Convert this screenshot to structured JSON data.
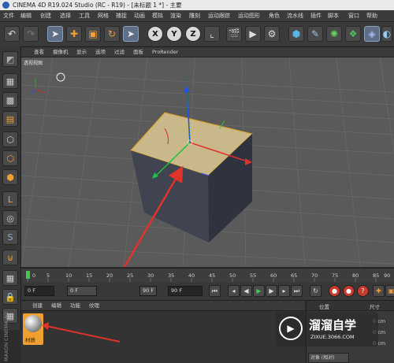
{
  "window": {
    "title": "CINEMA 4D R19.024 Studio (RC - R19) - [未标题 1 *] - 主要"
  },
  "menubar": {
    "items": [
      "文件",
      "编辑",
      "创建",
      "选择",
      "工具",
      "网格",
      "捕捉",
      "动画",
      "模拟",
      "渲染",
      "雕刻",
      "运动跟踪",
      "运动图形",
      "角色",
      "流水线",
      "插件",
      "脚本",
      "窗口",
      "帮助"
    ]
  },
  "toolbar": {
    "undo_icon": "undo-icon",
    "axis_x": "X",
    "axis_y": "Y",
    "axis_z": "Z"
  },
  "viewport": {
    "menu": [
      "查看",
      "摄像机",
      "显示",
      "选项",
      "过滤",
      "面板",
      "ProRender"
    ],
    "label": "透视视图"
  },
  "timeline": {
    "ticks": [
      "0",
      "5",
      "10",
      "15",
      "20",
      "25",
      "30",
      "35",
      "40",
      "45",
      "50",
      "55",
      "60",
      "65",
      "70",
      "75",
      "80",
      "85",
      "90"
    ]
  },
  "transport": {
    "start_field": "0 F",
    "current_field": "0 F",
    "end_field": "90 F",
    "end_field2": "90 F"
  },
  "material_panel": {
    "menu": [
      "创建",
      "编辑",
      "功能",
      "纹理"
    ],
    "material_name": "材质"
  },
  "attr_panel": {
    "header_left": "位置",
    "header_right": "尺寸",
    "rows": [
      "0 cm",
      "0 cm",
      "0 cm"
    ],
    "mode": "对象 (相对)"
  },
  "watermark": {
    "brand": "溜溜自学",
    "url": "ZIXUE.3066.COM"
  },
  "side_brand": {
    "text": "MAXON CINEMA 4D"
  },
  "colors": {
    "accent_orange": "#f0a030",
    "annotation_red": "#e0332a",
    "cube_top": "#c9b889",
    "cube_side": "#3f4450"
  }
}
